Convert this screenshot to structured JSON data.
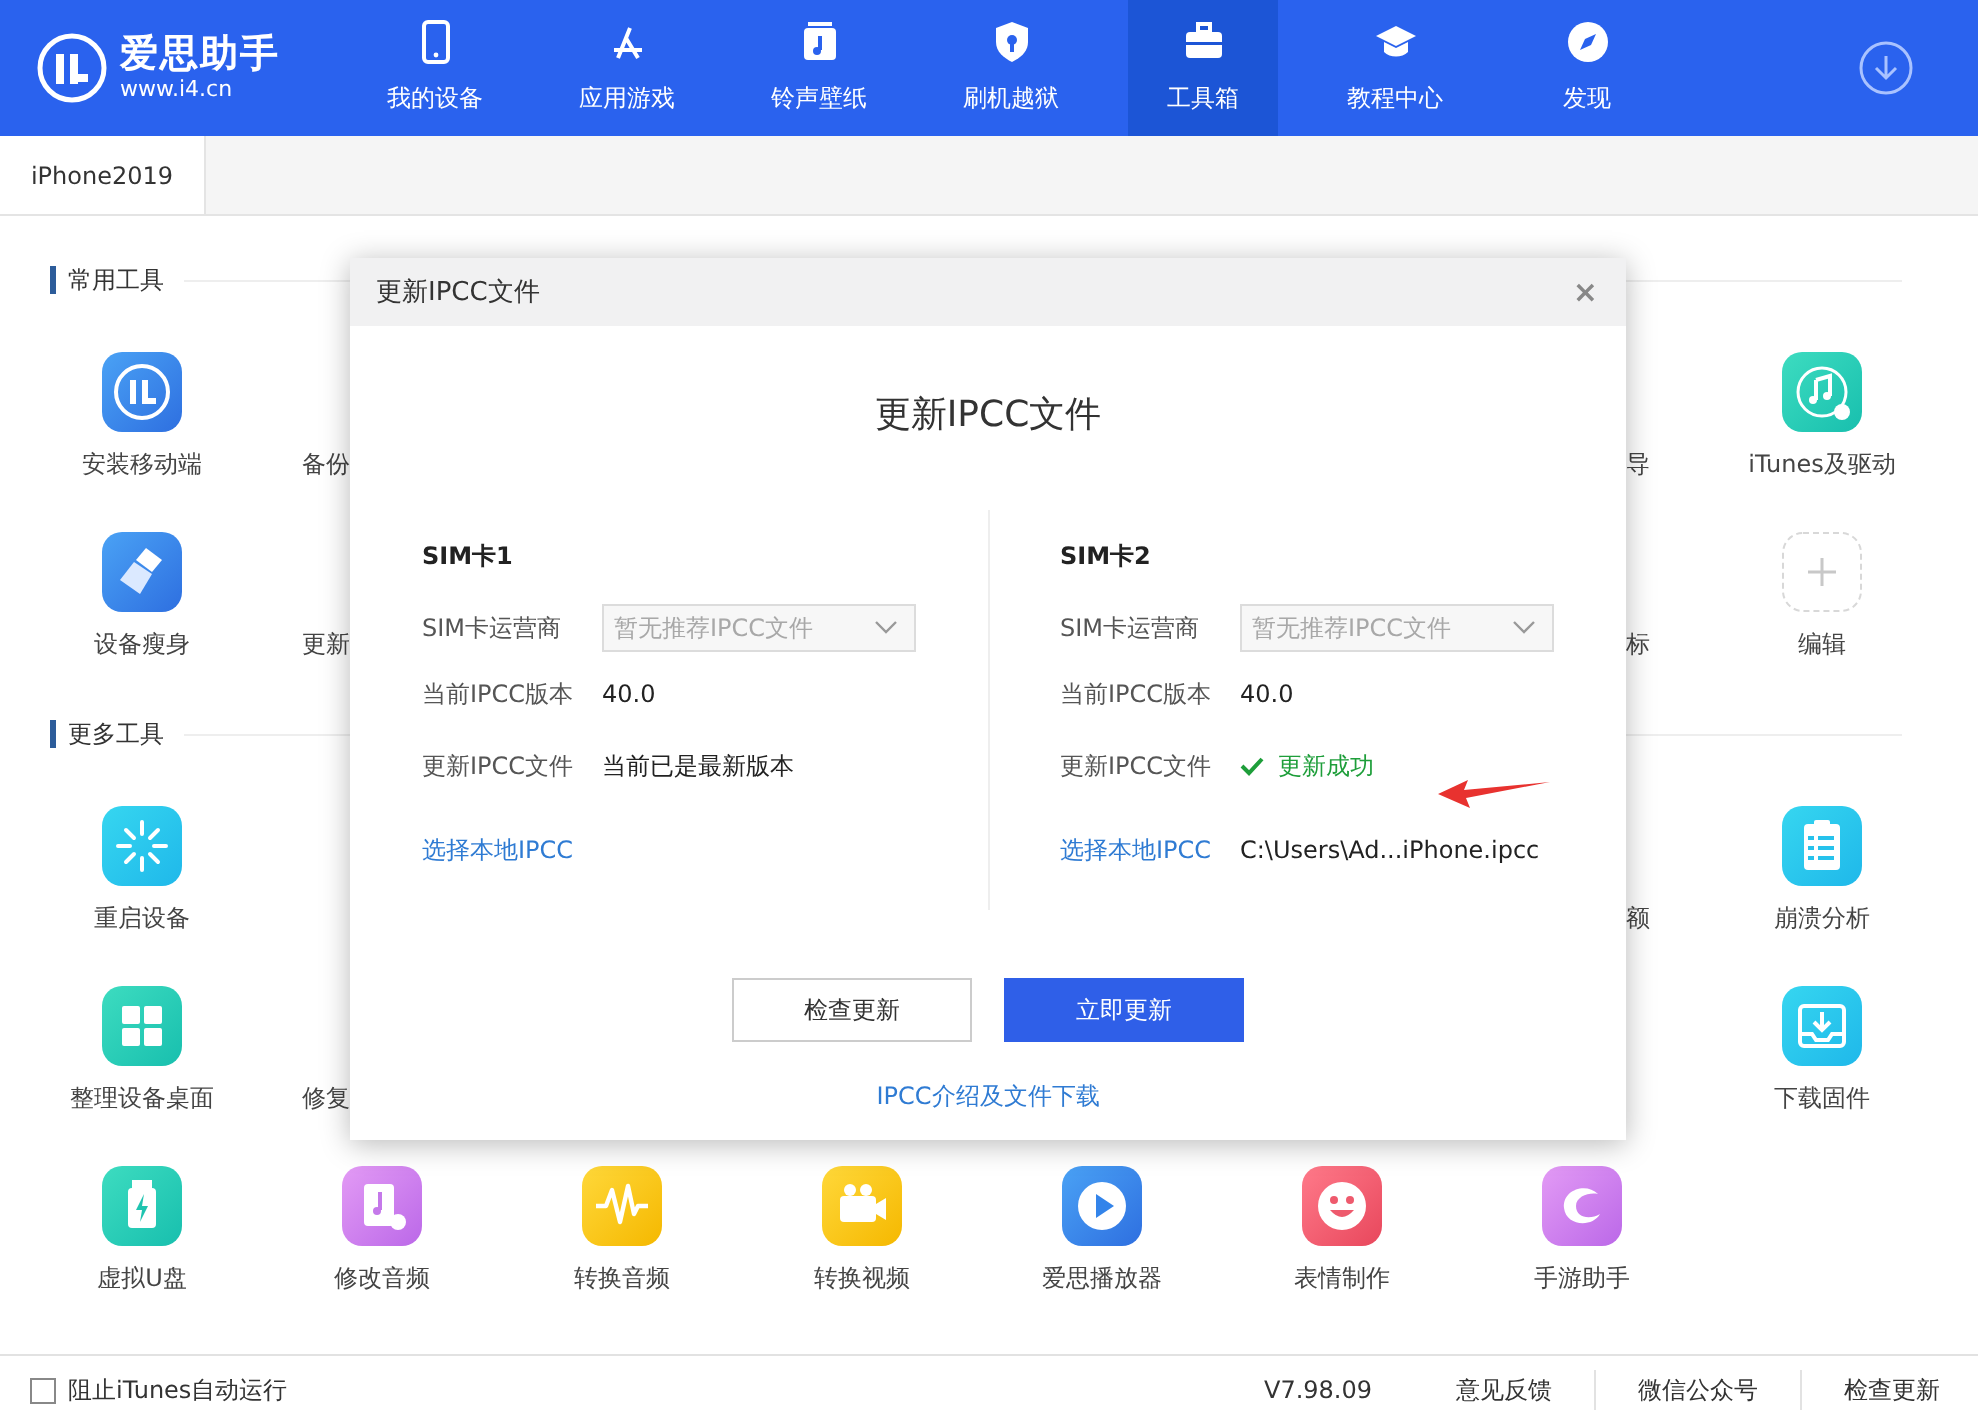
{
  "header": {
    "logo": {
      "name": "爱思助手",
      "url": "www.i4.cn"
    },
    "nav": [
      {
        "label": "我的设备",
        "kind": "phone",
        "selected": false
      },
      {
        "label": "应用游戏",
        "kind": "appstore",
        "selected": false
      },
      {
        "label": "铃声壁纸",
        "kind": "ringtone",
        "selected": false
      },
      {
        "label": "刷机越狱",
        "kind": "shield",
        "selected": false
      },
      {
        "label": "工具箱",
        "kind": "toolbox",
        "selected": true
      },
      {
        "label": "教程中心",
        "kind": "cap",
        "selected": false
      },
      {
        "label": "发现",
        "kind": "compass",
        "selected": false
      }
    ]
  },
  "device_tabs": [
    {
      "label": "iPhone2019",
      "selected": true
    }
  ],
  "sections": [
    {
      "title": "常用工具",
      "rows": [
        [
          {
            "kind": "install",
            "label": "安装移动端"
          },
          {
            "kind": "clip-left",
            "label": "备份"
          },
          {
            "kind": "empty"
          },
          {
            "kind": "empty"
          },
          {
            "kind": "empty"
          },
          {
            "kind": "empty"
          },
          {
            "kind": "clip-right",
            "label": "导"
          },
          {
            "kind": "itunes",
            "label": "iTunes及驱动"
          }
        ],
        [
          {
            "kind": "clean",
            "label": "设备瘦身"
          },
          {
            "kind": "clip-left",
            "label": "更新"
          },
          {
            "kind": "empty"
          },
          {
            "kind": "empty"
          },
          {
            "kind": "empty"
          },
          {
            "kind": "empty"
          },
          {
            "kind": "clip-right",
            "label": "标"
          },
          {
            "kind": "add",
            "label": "编辑"
          }
        ]
      ]
    },
    {
      "title": "更多工具",
      "rows": [
        [
          {
            "kind": "restart",
            "label": "重启设备"
          },
          {
            "kind": "empty"
          },
          {
            "kind": "empty"
          },
          {
            "kind": "empty"
          },
          {
            "kind": "empty"
          },
          {
            "kind": "empty"
          },
          {
            "kind": "clip-right",
            "label": "额"
          },
          {
            "kind": "crash",
            "label": "崩溃分析"
          }
        ],
        [
          {
            "kind": "desktop",
            "label": "整理设备桌面"
          },
          {
            "kind": "clip-left",
            "label": "修复"
          },
          {
            "kind": "empty"
          },
          {
            "kind": "empty"
          },
          {
            "kind": "empty"
          },
          {
            "kind": "empty"
          },
          {
            "kind": "empty"
          },
          {
            "kind": "firmware",
            "label": "下载固件"
          }
        ],
        [
          {
            "kind": "usb",
            "label": "虚拟U盘"
          },
          {
            "kind": "audioedit",
            "label": "修改音频"
          },
          {
            "kind": "wave",
            "label": "转换音频"
          },
          {
            "kind": "video",
            "label": "转换视频"
          },
          {
            "kind": "player",
            "label": "爱思播放器"
          },
          {
            "kind": "emoji",
            "label": "表情制作"
          },
          {
            "kind": "game",
            "label": "手游助手"
          },
          {
            "kind": "empty"
          }
        ]
      ]
    }
  ],
  "dialog": {
    "title": "更新IPCC文件",
    "close": "×",
    "heading": "更新IPCC文件",
    "sims": [
      {
        "title": "SIM卡1",
        "carrier_label": "SIM卡运营商",
        "carrier_placeholder": "暂无推荐IPCC文件",
        "carrier_disabled": true,
        "version_label": "当前IPCC版本",
        "version": "40.0",
        "update_label": "更新IPCC文件",
        "update_status": {
          "kind": "plain",
          "text": "当前已是最新版本"
        },
        "local_label": "选择本地IPCC"
      },
      {
        "title": "SIM卡2",
        "carrier_label": "SIM卡运营商",
        "carrier_placeholder": "暂无推荐IPCC文件",
        "carrier_disabled": true,
        "version_label": "当前IPCC版本",
        "version": "40.0",
        "update_label": "更新IPCC文件",
        "update_status": {
          "kind": "success",
          "text": "更新成功"
        },
        "local_label": "选择本地IPCC",
        "local_path": "C:\\Users\\Ad...iPhone.ipcc"
      }
    ],
    "buttons": [
      {
        "label": "检查更新",
        "kind": "secondary"
      },
      {
        "label": "立即更新",
        "kind": "primary"
      }
    ],
    "link": "IPCC介绍及文件下载"
  },
  "footer": {
    "checkbox": {
      "label": "阻止iTunes自动运行",
      "checked": false
    },
    "version": "V7.98.09",
    "links": [
      "意见反馈",
      "微信公众号",
      "检查更新"
    ]
  }
}
